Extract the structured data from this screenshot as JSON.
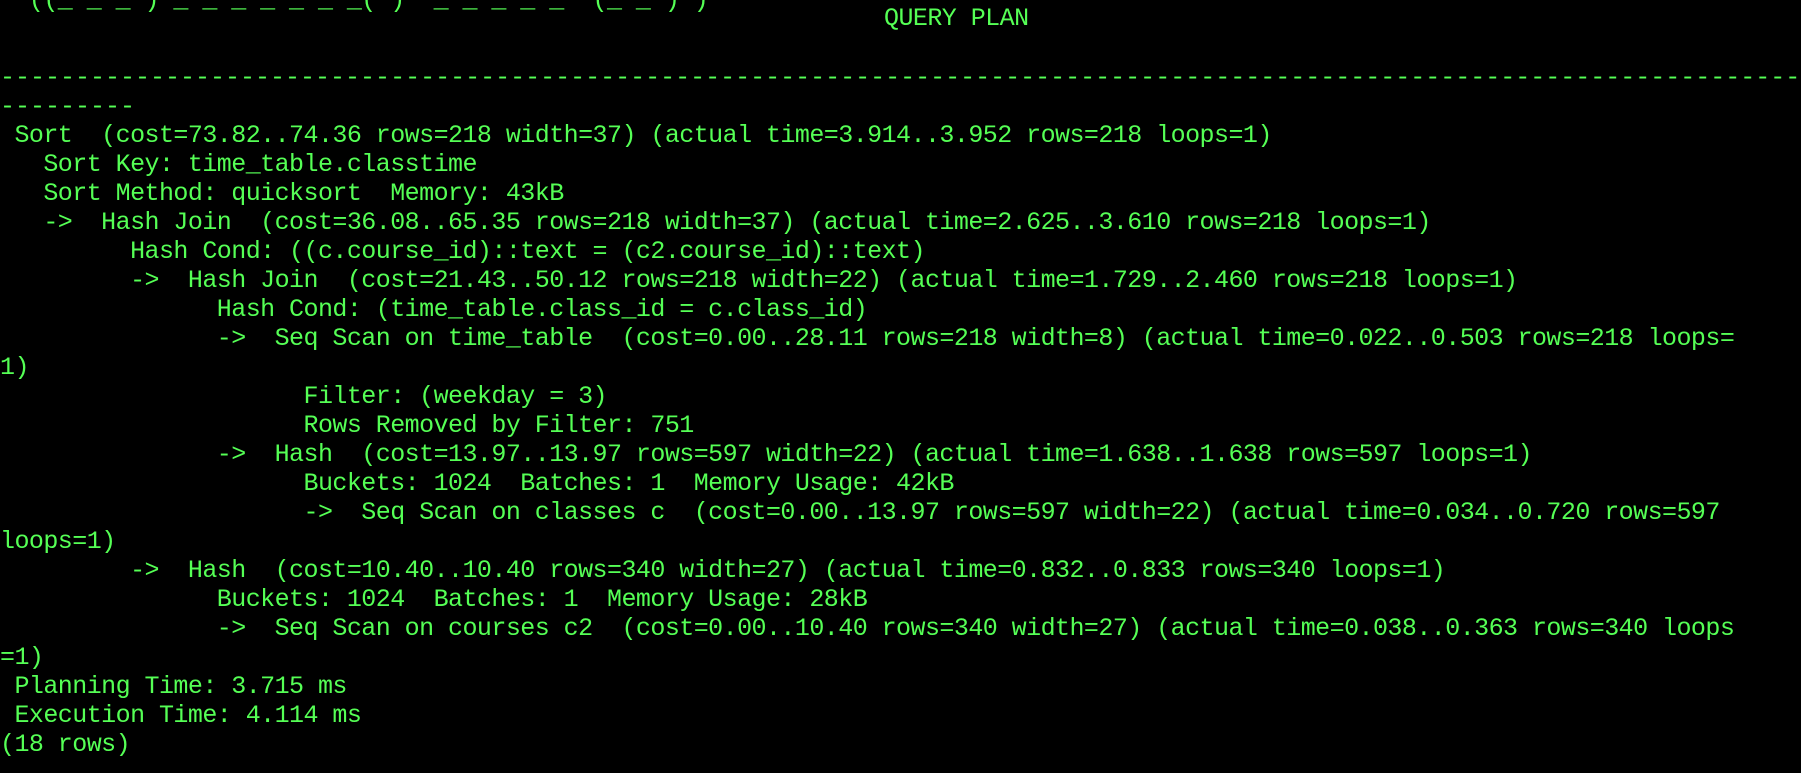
{
  "terminal": {
    "background": "#000000",
    "foreground": "#55ff55",
    "partial_top_line": "  ((_ _ _ ) _ _ _ _ _ _ _( )  _ _ _ _ _  (_ _ ) )",
    "header": "QUERY PLAN",
    "divider": "-------------------------------------------------------------------------------------------------------------------------------------------------------------------------",
    "divider_tail": "---------",
    "lines": [
      " Sort  (cost=73.82..74.36 rows=218 width=37) (actual time=3.914..3.952 rows=218 loops=1)",
      "   Sort Key: time_table.classtime",
      "   Sort Method: quicksort  Memory: 43kB",
      "   ->  Hash Join  (cost=36.08..65.35 rows=218 width=37) (actual time=2.625..3.610 rows=218 loops=1)",
      "         Hash Cond: ((c.course_id)::text = (c2.course_id)::text)",
      "         ->  Hash Join  (cost=21.43..50.12 rows=218 width=22) (actual time=1.729..2.460 rows=218 loops=1)",
      "               Hash Cond: (time_table.class_id = c.class_id)",
      "               ->  Seq Scan on time_table  (cost=0.00..28.11 rows=218 width=8) (actual time=0.022..0.503 rows=218 loops=",
      "1)",
      "                     Filter: (weekday = 3)",
      "                     Rows Removed by Filter: 751",
      "               ->  Hash  (cost=13.97..13.97 rows=597 width=22) (actual time=1.638..1.638 rows=597 loops=1)",
      "                     Buckets: 1024  Batches: 1  Memory Usage: 42kB",
      "                     ->  Seq Scan on classes c  (cost=0.00..13.97 rows=597 width=22) (actual time=0.034..0.720 rows=597",
      "loops=1)",
      "         ->  Hash  (cost=10.40..10.40 rows=340 width=27) (actual time=0.832..0.833 rows=340 loops=1)",
      "               Buckets: 1024  Batches: 1  Memory Usage: 28kB",
      "               ->  Seq Scan on courses c2  (cost=0.00..10.40 rows=340 width=27) (actual time=0.038..0.363 rows=340 loops",
      "=1)",
      " Planning Time: 3.715 ms",
      " Execution Time: 4.114 ms",
      "(18 rows)"
    ]
  }
}
